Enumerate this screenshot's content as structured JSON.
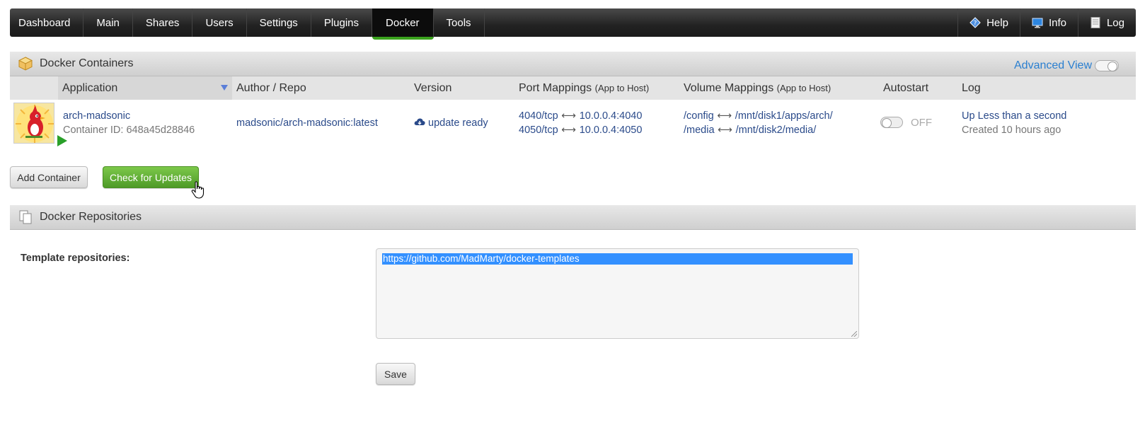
{
  "nav": {
    "tabs": [
      "Dashboard",
      "Main",
      "Shares",
      "Users",
      "Settings",
      "Plugins",
      "Docker",
      "Tools"
    ],
    "active_tab": "Docker",
    "help": "Help",
    "info": "Info",
    "log": "Log"
  },
  "containers_section": {
    "title": "Docker Containers",
    "advanced_view": "Advanced View",
    "columns": {
      "application": "Application",
      "author_repo": "Author / Repo",
      "version": "Version",
      "port_mappings": "Port Mappings",
      "port_mappings_sub": "(App to Host)",
      "volume_mappings": "Volume Mappings",
      "volume_mappings_sub": "(App to Host)",
      "autostart": "Autostart",
      "log": "Log"
    },
    "container": {
      "name": "arch-madsonic",
      "container_id": "Container ID: 648a45d28846",
      "repo": "madsonic/arch-madsonic:latest",
      "version_status": "update ready",
      "ports": [
        {
          "app": "4040/tcp",
          "host": "10.0.0.4:4040"
        },
        {
          "app": "4050/tcp",
          "host": "10.0.0.4:4050"
        }
      ],
      "volumes": [
        {
          "app": "/config",
          "host": "/mnt/disk1/apps/arch/"
        },
        {
          "app": "/media",
          "host": "/mnt/disk2/media/"
        }
      ],
      "autostart": "OFF",
      "status": "Up Less than a second",
      "created": "Created 10 hours ago"
    },
    "buttons": {
      "add_container": "Add Container",
      "check_updates": "Check for Updates"
    }
  },
  "repositories_section": {
    "title": "Docker Repositories",
    "label": "Template repositories:",
    "textarea_value": "https://github.com/MadMarty/docker-templates",
    "save": "Save"
  },
  "colors": {
    "accent_green": "#3aa21d",
    "link_blue": "#2a4a8a",
    "advanced_blue": "#2a7fd0",
    "selection_blue": "#3390ff"
  }
}
